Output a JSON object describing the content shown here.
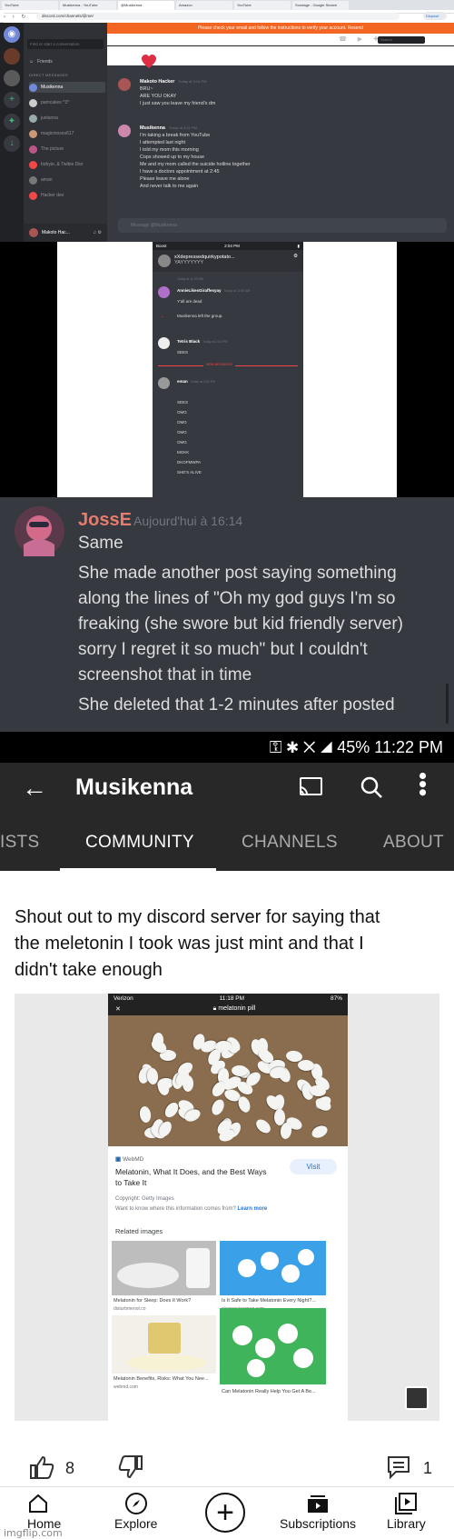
{
  "desktop": {
    "tabs": [
      "YouTube",
      "Musikenna - YouTube",
      "@Musikenna",
      "Amazon",
      "YouTube",
      "Sondage - Google Search"
    ],
    "url": "discord.com/channels/@me/",
    "profile_label": "Disposé",
    "notice": "Please check your email and follow the instructions to verify your account.   Resend",
    "dm_search": "Find or start a conversation",
    "friends": "Friends",
    "dm_header": "DIRECT MESSAGES",
    "dms": [
      {
        "name": "Musikenna"
      },
      {
        "name": "pamcakes ^3^"
      },
      {
        "name": "justanna"
      },
      {
        "name": "magicmoses617"
      },
      {
        "name": "The picture"
      },
      {
        "name": "bobyie, & Twibie Dior"
      },
      {
        "name": "aman"
      },
      {
        "name": "Hacker dev"
      }
    ],
    "user": "Makoto Hac...",
    "channel": "Musikenna",
    "search": "Search",
    "messages": [
      {
        "author": "Makoto Hacker",
        "time": "Today at 3:14 PM",
        "lines": [
          "BRU~",
          "ARE YOU OKAY",
          "I just saw you leave my friend's dm"
        ]
      },
      {
        "author": "Musikenna",
        "time": "Today at 3:22 PM",
        "lines": [
          "I'm taking a break from YouTube",
          "I attempted last night",
          "I told my mom this morning",
          "Cops showed up to my house",
          "Me and my mom called the suicide hotline together",
          "I have a doctors appointment at 2:45",
          "Please leave me alone",
          "And never talk to me again"
        ]
      }
    ],
    "input_placeholder": "Message @Musikenna"
  },
  "mobile": {
    "carrier": "Boost",
    "clock": "2:04 PM",
    "group_name": "xXdepressedquirkypotato...",
    "group_sub": "YAYYYYYYY",
    "group_ts": "Today at 11:23 AM",
    "messages": [
      {
        "author": "AnnieLikesGiraffesyay",
        "time": "Today at 11:55 AM",
        "text": "Y'all are dead"
      },
      {
        "author": "",
        "time": "",
        "text": "Musikenna left the group."
      },
      {
        "author": "Tetris Black",
        "time": "Today at 2:01 PM",
        "text": "SEES"
      }
    ],
    "new_label": "NEW MESSAGES",
    "last_author": "eman",
    "last_time": "Today at 2:02 PM",
    "last_lines": [
      "SEES",
      "OMG",
      "OMG",
      "OMG",
      "OMG",
      "MGKK",
      "DKOFMWPA",
      "SHE'S ALIVE"
    ]
  },
  "josse": {
    "name": "JossE",
    "time": "Aujourd'hui à 16:14",
    "lines": [
      "Same",
      "She made another post saying something",
      "along the lines of \"Oh my god guys I'm so",
      "freaking (she swore but kid friendly server)",
      "sorry I regret it so much\" but I couldn't",
      "screenshot that in time",
      "She deleted that 1-2 minutes after posted"
    ]
  },
  "youtube": {
    "status": "45%  11:22 PM",
    "channel": "Musikenna",
    "tabs": [
      "ISTS",
      "COMMUNITY",
      "CHANNELS",
      "ABOUT"
    ],
    "post_lines": [
      "Shout out to my discord server for saying that",
      "the meletonin I took was just mint and that I",
      "didn't take enough"
    ],
    "shot": {
      "carrier": "Verizon",
      "clock": "11:18 PM",
      "battery": "87%",
      "search": "melatonin pill",
      "source": "WebMD",
      "title": "Melatonin, What It Does, and the Best Ways to Take It",
      "visit": "Visit",
      "copyright": "Copyright: Getty Images",
      "info": "Want to know where this information comes from?",
      "learn": "Learn more",
      "related": "Related images",
      "items": [
        {
          "caption": "Melatonin for Sleep: Does It Work?",
          "source": "disturbmenot.co"
        },
        {
          "caption": "Is It Safe to Take Melatonin Every Night?...",
          "source": "sleepreviewmag.com"
        },
        {
          "caption": "Melatonin Benefits, Risks: What You Nee...",
          "source": "webmd.com"
        },
        {
          "caption": "Can Melatonin Really Help You Get A Be...",
          "source": ""
        }
      ]
    },
    "likes": "8",
    "comments": "1",
    "nav": [
      "Home",
      "Explore",
      "Subscriptions",
      "Library"
    ]
  },
  "watermark": "imgflip.com"
}
